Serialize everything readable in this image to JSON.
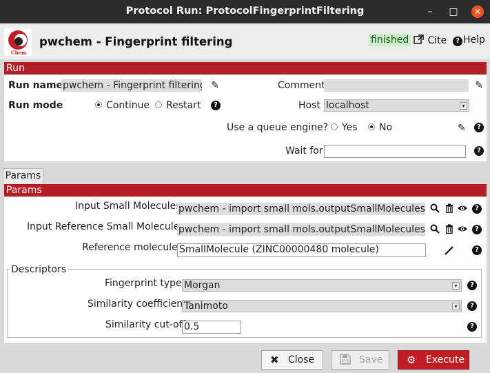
{
  "window": {
    "title": "Protocol Run: ProtocolFingerprintFiltering",
    "minimize_glyph": "–",
    "maximize_glyph": "□",
    "close_glyph": "✕"
  },
  "header": {
    "logo_text": "Chem",
    "title": "pwchem - Fingerprint filtering",
    "status": "finished",
    "cite_label": "Cite",
    "help_label": "Help",
    "status_color": "#c7f0c7"
  },
  "run": {
    "section_label": "Run",
    "run_name_label": "Run name",
    "run_name_value": "pwchem - Fingerprint filtering",
    "comment_label": "Comment",
    "comment_value": "",
    "run_mode_label": "Run mode",
    "mode_continue": "Continue",
    "mode_restart": "Restart",
    "host_label": "Host",
    "host_value": "localhost",
    "queue_label": "Use a queue engine?",
    "queue_yes": "Yes",
    "queue_no": "No",
    "wait_for_label": "Wait for",
    "wait_for_value": ""
  },
  "tabs": [
    {
      "label": "Params"
    }
  ],
  "params": {
    "section_label": "Params",
    "input_small_molecules_label": "Input Small Molecules:",
    "input_small_molecules_value": "pwchem - import small mols.outputSmallMolecules",
    "input_reference_label": "Input Reference Small Molecules:",
    "input_reference_value": "pwchem - import small mols.outputSmallMolecules",
    "reference_molecule_label": "Reference molecule:",
    "reference_molecule_value": "SmallMolecule (ZINC00000480 molecule)"
  },
  "descriptors": {
    "legend": "Descriptors",
    "fingerprint_label": "Fingerprint type:",
    "fingerprint_value": "Morgan",
    "similarity_coef_label": "Similarity coefficient:",
    "similarity_coef_value": "Tanimoto",
    "cutoff_label": "Similarity cut-off:",
    "cutoff_value": "0.5"
  },
  "footer": {
    "close_label": "Close",
    "save_label": "Save",
    "execute_label": "Execute",
    "accent_color": "#c01e24"
  }
}
